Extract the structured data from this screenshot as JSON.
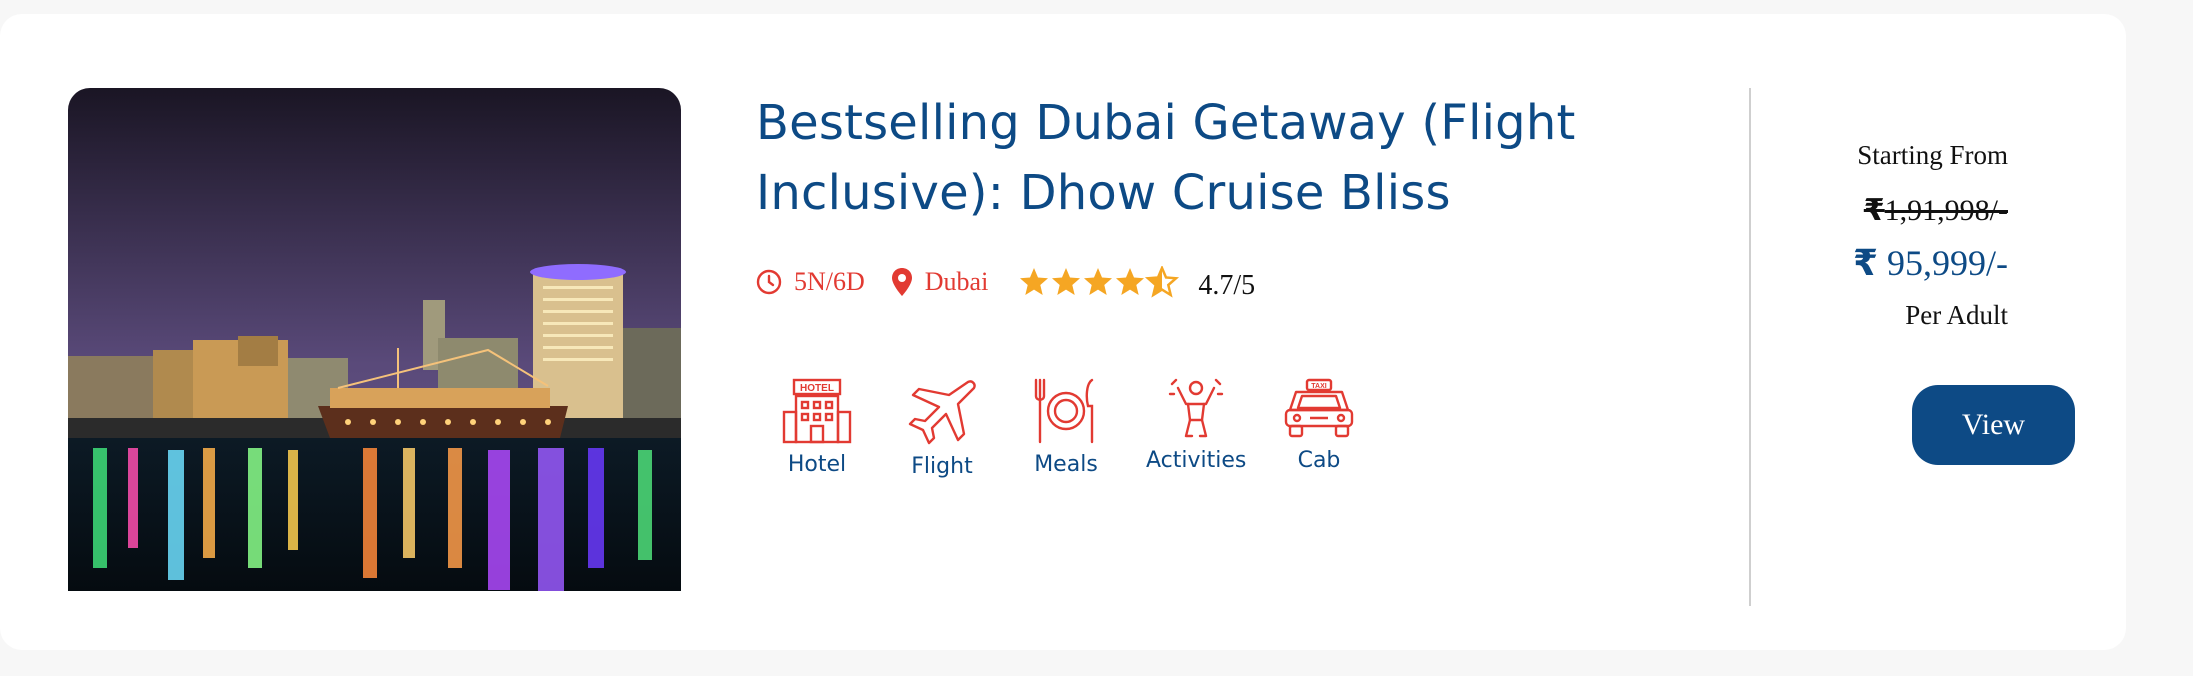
{
  "package": {
    "title": "Bestselling Dubai Getaway (Flight Inclusive): Dhow Cruise Bliss",
    "duration": "5N/6D",
    "destination": "Dubai",
    "rating": "4.7/5",
    "rating_value": 4.7,
    "rating_max": 5
  },
  "amenities": [
    {
      "label": "Hotel",
      "icon": "hotel-icon",
      "badge": "HOTEL"
    },
    {
      "label": "Flight",
      "icon": "airplane-icon"
    },
    {
      "label": "Meals",
      "icon": "meals-icon"
    },
    {
      "label": "Activities",
      "icon": "activities-icon"
    },
    {
      "label": "Cab",
      "icon": "taxi-icon",
      "badge": "TAXI"
    }
  ],
  "pricing": {
    "starting_label": "Starting From",
    "currency": "₹",
    "original_price": "1,91,998/-",
    "offer_price": "95,999/-",
    "unit": "Per Adult"
  },
  "actions": {
    "view_label": "View"
  },
  "colors": {
    "primary": "#0d4a85",
    "accent_red": "#e23a32",
    "star": "#f5a623",
    "background": "#f7f7f7",
    "card": "#ffffff"
  }
}
